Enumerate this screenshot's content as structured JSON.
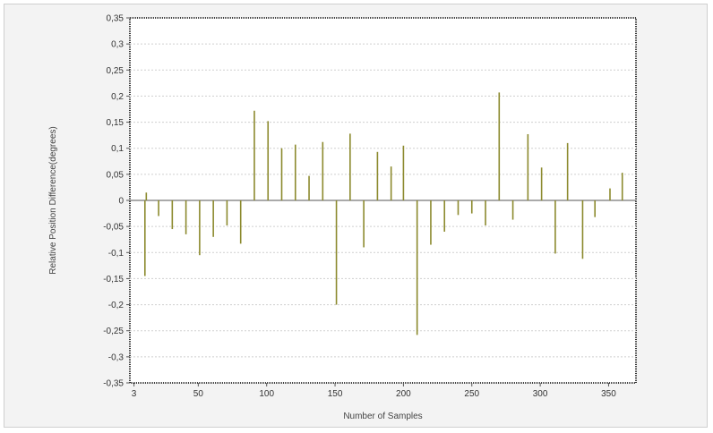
{
  "chart_data": {
    "type": "bar",
    "xlabel": "Number of Samples",
    "ylabel": "Relative Position Difference(degrees)",
    "xlim": [
      0,
      370
    ],
    "ylim": [
      -0.35,
      0.35
    ],
    "y_ticks": [
      "0,35",
      "0,3",
      "0,25",
      "0,2",
      "0,15",
      "0,1",
      "0,05",
      "0",
      "-0,05",
      "-0,1",
      "-0,15",
      "-0,2",
      "-0,25",
      "-0,3",
      "-0,35"
    ],
    "y_tick_values": [
      0.35,
      0.3,
      0.25,
      0.2,
      0.15,
      0.1,
      0.05,
      0,
      -0.05,
      -0.1,
      -0.15,
      -0.2,
      -0.25,
      -0.3,
      -0.35
    ],
    "x_ticks": [
      "3",
      "50",
      "100",
      "150",
      "200",
      "250",
      "300",
      "350"
    ],
    "x_tick_values": [
      3,
      50,
      100,
      150,
      200,
      250,
      300,
      350
    ],
    "grid": true,
    "bar_color": "#8c8a2e",
    "series": [
      {
        "x": [
          11,
          12,
          21,
          31,
          41,
          51,
          61,
          71,
          81,
          91,
          101,
          111,
          121,
          131,
          141,
          151,
          161,
          171,
          181,
          191,
          200,
          210,
          220,
          230,
          240,
          250,
          260,
          270,
          280,
          291,
          301,
          311,
          320,
          331,
          340,
          351,
          360
        ],
        "values": [
          -0.145,
          0.015,
          -0.03,
          -0.055,
          -0.065,
          -0.105,
          -0.07,
          -0.048,
          -0.083,
          0.172,
          0.152,
          0.1,
          0.107,
          0.047,
          0.112,
          -0.2,
          0.128,
          -0.09,
          0.093,
          0.065,
          0.105,
          -0.258,
          -0.085,
          -0.06,
          -0.028,
          -0.025,
          -0.048,
          0.207,
          -0.037,
          0.127,
          0.063,
          -0.102,
          0.11,
          -0.112,
          -0.032,
          0.023,
          0.053
        ]
      }
    ]
  }
}
